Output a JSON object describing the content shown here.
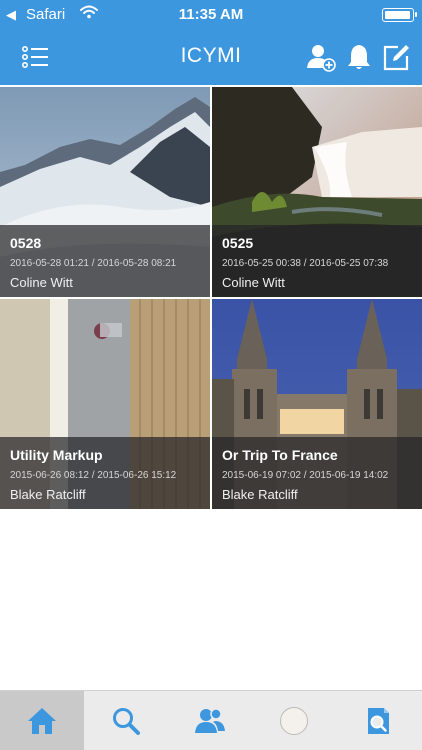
{
  "status_bar": {
    "back_app": "Safari",
    "time": "11:35 AM"
  },
  "header": {
    "title": "ICYMI",
    "icons": [
      "menu-list-icon",
      "add-user-icon",
      "bell-icon",
      "compose-icon"
    ]
  },
  "cards": [
    {
      "title": "0528",
      "dates": "2016-05-28 01:21 / 2016-05-28 08:21",
      "author": "Coline Witt"
    },
    {
      "title": "0525",
      "dates": "2016-05-25 00:38 / 2016-05-25 07:38",
      "author": "Coline Witt"
    },
    {
      "title": "Utility Markup",
      "dates": "2015-06-26 08:12 / 2015-06-26 15:12",
      "author": "Blake Ratcliff"
    },
    {
      "title": "Or Trip To France",
      "dates": "2015-06-19 07:02 / 2015-06-19 14:02",
      "author": "Blake Ratcliff"
    }
  ],
  "tabbar": {
    "items": [
      "home-icon",
      "search-icon",
      "people-icon",
      "avatar",
      "document-search-icon"
    ],
    "active": "home-icon"
  },
  "colors": {
    "accent": "#3d97de",
    "tab_active_bg": "#c9c9c9"
  }
}
